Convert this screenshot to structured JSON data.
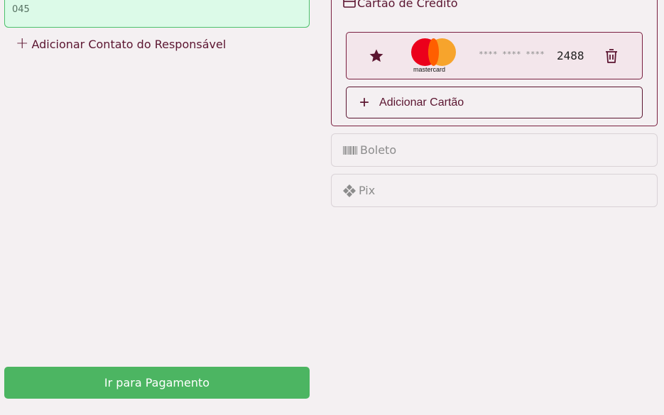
{
  "contact": {
    "phone_fragment": "045"
  },
  "actions": {
    "add_contact_label": "Adicionar Contato do Responsável",
    "pay_label": "Ir para Pagamento"
  },
  "payment": {
    "credit_card_title": "Cartão de Crédito",
    "saved_card": {
      "brand": "mastercard",
      "masked": "**** **** ****",
      "last4": "2488"
    },
    "add_card_label": "Adicionar Cartão",
    "methods": [
      {
        "label": "Boleto",
        "icon": "barcode-icon"
      },
      {
        "label": "Pix",
        "icon": "pix-icon"
      }
    ]
  },
  "colors": {
    "accent": "#5b1530",
    "primary_button": "#4cb562",
    "selected_contact_bg": "#dcfae8",
    "mastercard_red": "#eb001b",
    "mastercard_orange": "#f79e1b"
  }
}
